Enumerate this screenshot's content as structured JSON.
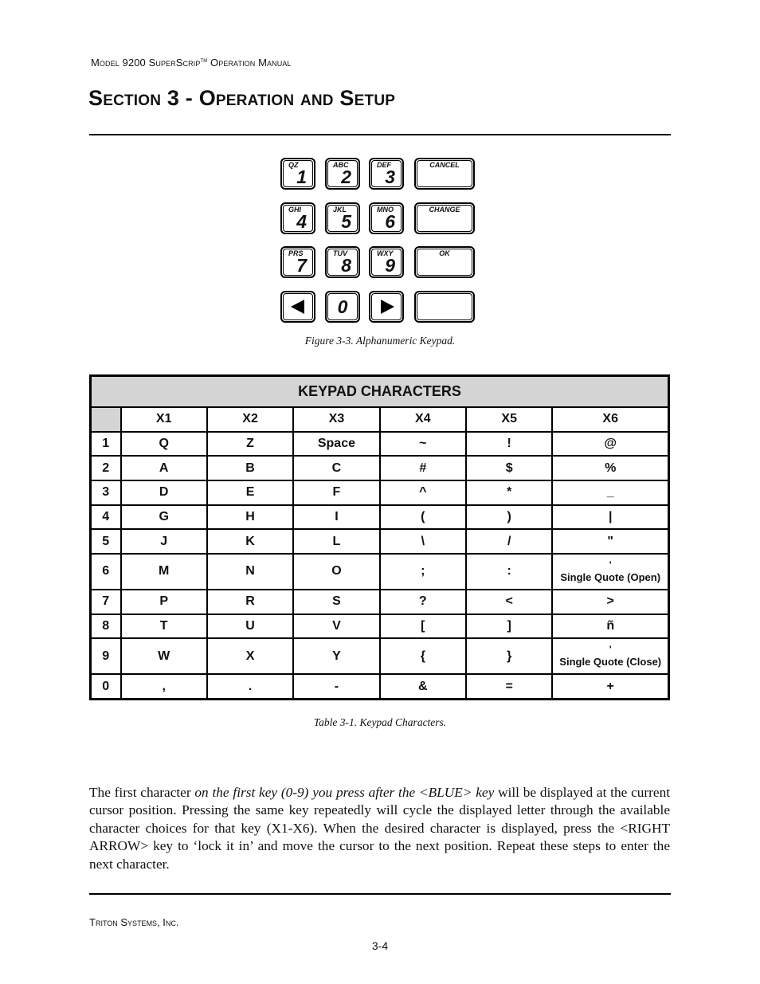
{
  "header": {
    "running_title_pre": "Model 9200 SuperScrip",
    "trademark": "TM",
    "running_title_post": " Operation Manual",
    "section_title": "Section 3 - Operation and Setup"
  },
  "keypad": {
    "keys": [
      {
        "letters": "QZ",
        "digit": "1"
      },
      {
        "letters": "ABC",
        "digit": "2"
      },
      {
        "letters": "DEF",
        "digit": "3"
      },
      {
        "label": "CANCEL"
      },
      {
        "letters": "GHI",
        "digit": "4"
      },
      {
        "letters": "JKL",
        "digit": "5"
      },
      {
        "letters": "MNO",
        "digit": "6"
      },
      {
        "label": "CHANGE"
      },
      {
        "letters": "PRS",
        "digit": "7"
      },
      {
        "letters": "TUV",
        "digit": "8"
      },
      {
        "letters": "WXY",
        "digit": "9"
      },
      {
        "label": "OK"
      },
      {
        "icon": "left-arrow-icon"
      },
      {
        "digit": "0"
      },
      {
        "icon": "right-arrow-icon"
      },
      {
        "label": ""
      }
    ],
    "caption": "Figure 3-3.  Alphanumeric Keypad."
  },
  "table": {
    "title": "KEYPAD CHARACTERS",
    "columns": [
      "X1",
      "X2",
      "X3",
      "X4",
      "X5",
      "X6"
    ],
    "rows": [
      {
        "key": "1",
        "cells": [
          "Q",
          "Z",
          "Space",
          "~",
          "!",
          "@"
        ]
      },
      {
        "key": "2",
        "cells": [
          "A",
          "B",
          "C",
          "#",
          "$",
          "%"
        ]
      },
      {
        "key": "3",
        "cells": [
          "D",
          "E",
          "F",
          "^",
          "*",
          "_"
        ]
      },
      {
        "key": "4",
        "cells": [
          "G",
          "H",
          "I",
          "(",
          ")",
          "|"
        ]
      },
      {
        "key": "5",
        "cells": [
          "J",
          "K",
          "L",
          "\\",
          "/",
          "\""
        ]
      },
      {
        "key": "6",
        "cells": [
          "M",
          "N",
          "O",
          ";",
          ":",
          "'"
        ],
        "note": "Single Quote (Open)"
      },
      {
        "key": "7",
        "cells": [
          "P",
          "R",
          "S",
          "?",
          "<",
          ">"
        ]
      },
      {
        "key": "8",
        "cells": [
          "T",
          "U",
          "V",
          "[",
          "]",
          "ñ"
        ]
      },
      {
        "key": "9",
        "cells": [
          "W",
          "X",
          "Y",
          "{",
          "}",
          "'"
        ],
        "note": "Single Quote (Close)"
      },
      {
        "key": "0",
        "cells": [
          ",",
          ".",
          "-",
          "&",
          "=",
          "+"
        ]
      }
    ],
    "caption": "Table 3-1.  Keypad Characters."
  },
  "body": {
    "p1_a": "The first character ",
    "p1_em": "on the first key (0-9) you press after the <BLUE> key",
    "p1_b": " will be displayed at the current cursor position.  Pressing the same key repeatedly will cycle the displayed letter through the available character choices for that key (X1-X6).  When the desired character is displayed, press the <RIGHT ARROW> key to ‘lock it in’ and move the cursor to the next position.  Repeat these steps to enter the next character."
  },
  "footer": {
    "company": "Triton Systems, Inc.",
    "page_number": "3-4"
  }
}
